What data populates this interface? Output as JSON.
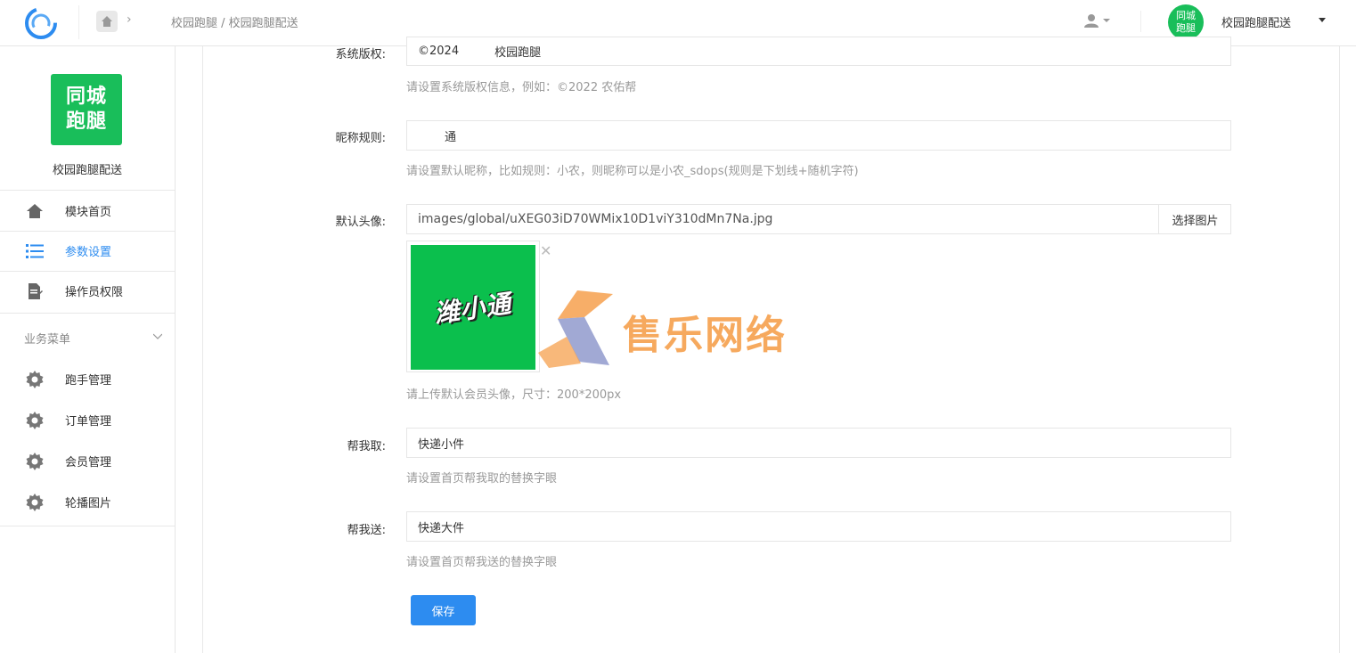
{
  "topbar": {
    "breadcrumb_text": "校园跑腿 / 校园跑腿配送",
    "avatar_text_line1": "同城",
    "avatar_text_line2": "跑腿",
    "shop_name": "校园跑腿配送"
  },
  "sidebar": {
    "logo_line1": "同城",
    "logo_line2": "跑腿",
    "shop_name": "校园跑腿配送",
    "items": [
      {
        "label": "模块首页",
        "icon": "home-icon"
      },
      {
        "label": "参数设置",
        "icon": "list-icon",
        "active": true
      },
      {
        "label": "操作员权限",
        "icon": "document-edit-icon"
      }
    ],
    "group_label": "业务菜单",
    "group_items": [
      {
        "label": "跑手管理",
        "icon": "gear-icon"
      },
      {
        "label": "订单管理",
        "icon": "gear-icon"
      },
      {
        "label": "会员管理",
        "icon": "gear-icon"
      },
      {
        "label": "轮播图片",
        "icon": "gear-icon"
      }
    ]
  },
  "form": {
    "copyright": {
      "label": "系统版权:",
      "value": "©2024",
      "value_suffix": "校园跑腿",
      "hint": "请设置系统版权信息，例如：©2022 农佑帮"
    },
    "nickname": {
      "label": "昵称规则:",
      "value": "通",
      "hint": "请设置默认昵称，比如规则：小农，则昵称可以是小农_sdops(规则是下划线+随机字符)"
    },
    "avatar": {
      "label": "默认头像:",
      "value": "images/global/uXEG03iD70WMix10D1viY310dMn7Na.jpg",
      "pick_button": "选择图片",
      "image_text": "潍小通",
      "hint": "请上传默认会员头像，尺寸：200*200px"
    },
    "fetch": {
      "label": "帮我取:",
      "value": "快递小件",
      "hint": "请设置首页帮我取的替换字眼"
    },
    "send": {
      "label": "帮我送:",
      "value": "快递大件",
      "hint": "请设置首页帮我送的替换字眼"
    },
    "save_button": "保存"
  },
  "watermark": {
    "text": "售乐网络"
  },
  "colors": {
    "brand_green": "#19be5a",
    "primary_blue": "#2d8cf0",
    "watermark_orange": "#f6a04d"
  }
}
